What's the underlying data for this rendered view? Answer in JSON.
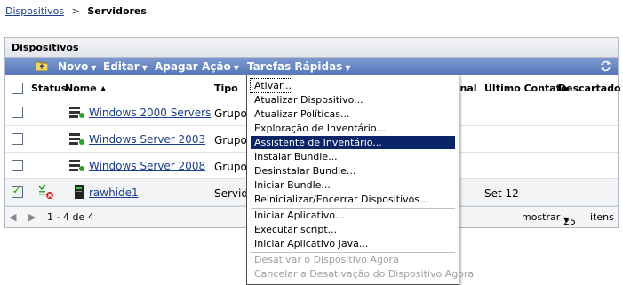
{
  "breadcrumb": {
    "parent": "Dispositivos",
    "separator": ">",
    "current": "Servidores"
  },
  "panel": {
    "title": "Dispositivos"
  },
  "toolbar": {
    "new_label": "Novo",
    "edit_label": "Editar",
    "delete_label": "Apagar",
    "action_label": "Ação",
    "quick_tasks_label": "Tarefas Rápidas"
  },
  "table": {
    "headers": {
      "status": "Status",
      "name": "Nome",
      "sort": "▲",
      "type": "Tipo",
      "operational": "onal",
      "last_contact": "Último Contato",
      "discarded": "Descartado"
    },
    "rows": [
      {
        "name": "Windows 2000 Servers",
        "type": "Grupo",
        "last_contact": "",
        "checked": false
      },
      {
        "name": "Windows Server 2003",
        "type": "Grupo",
        "last_contact": "",
        "checked": false
      },
      {
        "name": "Windows Server 2008",
        "type": "Grupo",
        "last_contact": "",
        "checked": false
      },
      {
        "name": "rawhide1",
        "type": "Servid",
        "last_contact": "Set 12",
        "checked": true
      }
    ]
  },
  "pagination": {
    "range": "1 - 4 de 4",
    "show_label": "mostrar",
    "page_size": "25",
    "items_label": "itens"
  },
  "menu": {
    "items": [
      {
        "label": "Ativar...",
        "state": "focus"
      },
      {
        "label": "Atualizar Dispositivo...",
        "state": ""
      },
      {
        "label": "Atualizar Políticas...",
        "state": ""
      },
      {
        "label": "Exploração de Inventário...",
        "state": ""
      },
      {
        "label": "Assistente de Inventário...",
        "state": "selected"
      },
      {
        "label": "Instalar Bundle...",
        "state": ""
      },
      {
        "label": "Desinstalar Bundle...",
        "state": ""
      },
      {
        "label": "Iniciar Bundle...",
        "state": ""
      },
      {
        "label": "Reinicializar/Encerrar Dispositivos...",
        "state": ""
      },
      {
        "label": "Iniciar Aplicativo...",
        "state": ""
      },
      {
        "label": "Executar script...",
        "state": ""
      },
      {
        "label": "Iniciar Aplicativo Java...",
        "state": ""
      },
      {
        "label": "Desativar o Dispositivo Agora",
        "state": "disabled"
      },
      {
        "label": "Cancelar a Desativação do Dispositivo Agora",
        "state": "disabled"
      }
    ]
  },
  "colors": {
    "toolbar": "#5476b8",
    "link": "#1a3e8c",
    "menu_selected": "#0a246a"
  }
}
